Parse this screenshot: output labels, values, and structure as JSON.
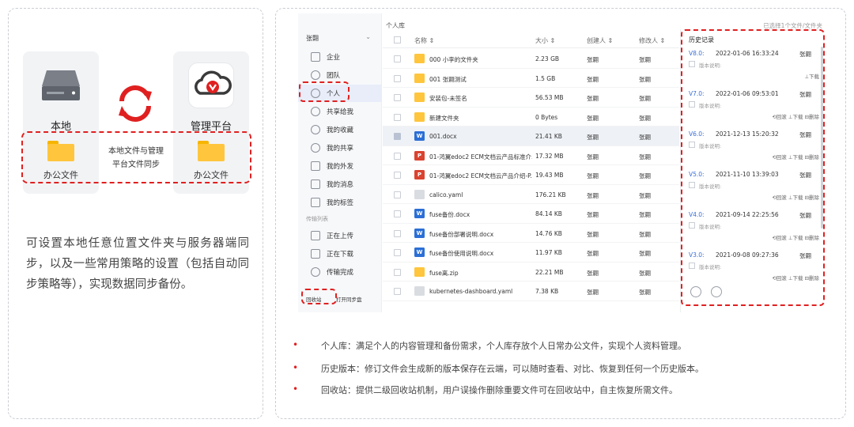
{
  "left": {
    "local_label": "本地",
    "platform_label": "管理平台",
    "local_folder": "办公文件",
    "platform_folder": "办公文件",
    "sync_caption_1": "本地文件与管理",
    "sync_caption_2": "平台文件同步",
    "description": "可设置本地任意位置文件夹与服务器端同步，以及一些常用策略的设置（包括自动同步策略等），实现数据同步备份。"
  },
  "app": {
    "breadcrumb": "个人库",
    "selected_info": "已选择1个文件/文件夹",
    "user": "张翾",
    "sidebar": [
      {
        "label": "企业"
      },
      {
        "label": "团队"
      },
      {
        "label": "个人"
      },
      {
        "label": "共享给我"
      },
      {
        "label": "我的收藏"
      },
      {
        "label": "我的共享"
      },
      {
        "label": "我的外发"
      },
      {
        "label": "我的消息"
      },
      {
        "label": "我的标签"
      }
    ],
    "transfer_header": "传输列表",
    "transfer": [
      {
        "label": "正在上传"
      },
      {
        "label": "正在下载"
      },
      {
        "label": "传输完成"
      }
    ],
    "recycle": "回收站",
    "sync_disk": "打开同步盘",
    "columns": {
      "name": "名称 ⇕",
      "size": "大小 ⇕",
      "creator": "创建人 ⇕",
      "modifier": "修改人 ⇕"
    },
    "files": [
      {
        "name": "000 小李的文件夹",
        "size": "2.23 GB",
        "creator": "张翾",
        "modifier": "张翾",
        "type": "folder"
      },
      {
        "name": "001 张翾测试",
        "size": "1.5 GB",
        "creator": "张翾",
        "modifier": "张翾",
        "type": "folder"
      },
      {
        "name": "安装包-未签名",
        "size": "56.53 MB",
        "creator": "张翾",
        "modifier": "张翾",
        "type": "folder"
      },
      {
        "name": "新建文件夹",
        "size": "0 Bytes",
        "creator": "张翾",
        "modifier": "张翾",
        "type": "folder"
      },
      {
        "name": "001.docx",
        "size": "21.41 KB",
        "creator": "张翾",
        "modifier": "张翾",
        "type": "word"
      },
      {
        "name": "01-鸿翼edoc2 ECM文档云产品标准介...",
        "size": "17.32 MB",
        "creator": "张翾",
        "modifier": "张翾",
        "type": "ppt"
      },
      {
        "name": "01-鸿翼edoc2 ECM文档云产品介绍-P...",
        "size": "19.43 MB",
        "creator": "张翾",
        "modifier": "张翾",
        "type": "ppt"
      },
      {
        "name": "calico.yaml",
        "size": "176.21 KB",
        "creator": "张翾",
        "modifier": "张翾",
        "type": "file"
      },
      {
        "name": "fuse备份.docx",
        "size": "84.14 KB",
        "creator": "张翾",
        "modifier": "张翾",
        "type": "word"
      },
      {
        "name": "fuse备份部署说明.docx",
        "size": "14.76 KB",
        "creator": "张翾",
        "modifier": "张翾",
        "type": "word"
      },
      {
        "name": "fuse备份使用说明.docx",
        "size": "11.97 KB",
        "creator": "张翾",
        "modifier": "张翾",
        "type": "word"
      },
      {
        "name": "fuse离.zip",
        "size": "22.21 MB",
        "creator": "张翾",
        "modifier": "张翾",
        "type": "zip"
      },
      {
        "name": "kubernetes-dashboard.yaml",
        "size": "7.38 KB",
        "creator": "张翾",
        "modifier": "张翾",
        "type": "file"
      }
    ],
    "history_title": "历史记录",
    "versions": [
      {
        "v": "V8.0:",
        "time": "2022-01-06 16:33:24",
        "user": "张翾",
        "desc": "版本说明:",
        "actions": "⊥下载"
      },
      {
        "v": "V7.0:",
        "time": "2022-01-06 09:53:01",
        "user": "张翾",
        "desc": "版本说明:",
        "actions": "⟲回滚   ⊥下载   ⊟删除"
      },
      {
        "v": "V6.0:",
        "time": "2021-12-13 15:20:32",
        "user": "张翾",
        "desc": "版本说明:",
        "actions": "⟲回滚   ⊥下载   ⊟删除"
      },
      {
        "v": "V5.0:",
        "time": "2021-11-10 13:39:03",
        "user": "张翾",
        "desc": "版本说明:",
        "actions": "⟲回滚   ⊥下载   ⊟删除"
      },
      {
        "v": "V4.0:",
        "time": "2021-09-14 22:25:56",
        "user": "张翾",
        "desc": "版本说明:",
        "actions": "⟲回滚   ⊥下载   ⊟删除"
      },
      {
        "v": "V3.0:",
        "time": "2021-09-08 09:27:36",
        "user": "张翾",
        "desc": "版本说明:",
        "actions": "⟲回滚   ⊥下载   ⊟删除"
      }
    ]
  },
  "bullets": [
    "个人库：满足个人的内容管理和备份需求，个人库存放个人日常办公文件，实现个人资料管理。",
    "历史版本：修订文件会生成新的版本保存在云端，可以随时查看、对比、恢复到任何一个历史版本。",
    "回收站：提供二级回收站机制，用户误操作删除重要文件可在回收站中，自主恢复所需文件。"
  ],
  "colors": {
    "accent_red": "#e02020",
    "folder": "#ffc53d",
    "word": "#2b6fd6",
    "ppt": "#d9432f",
    "version_blue": "#3b6fd6"
  }
}
